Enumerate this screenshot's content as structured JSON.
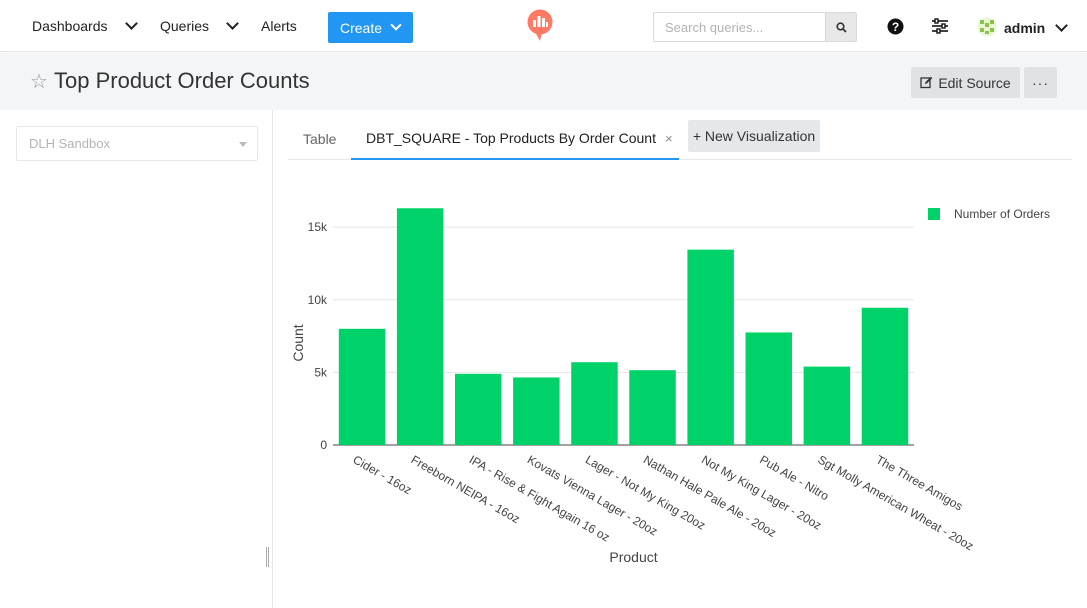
{
  "nav": {
    "dashboards": "Dashboards",
    "queries": "Queries",
    "alerts": "Alerts",
    "create": "Create",
    "search_placeholder": "Search queries...",
    "user": "admin"
  },
  "header": {
    "title": "Top Product Order Counts",
    "edit_source": "Edit Source",
    "more": "···"
  },
  "left": {
    "data_source": "DLH Sandbox"
  },
  "tabs": {
    "table": "Table",
    "active": "DBT_SQUARE - Top Products By Order Count",
    "close": "×",
    "new_visualization": "+ New Visualization"
  },
  "colors": {
    "accent": "#2196f3",
    "bar": "#00d26a"
  },
  "chart_data": {
    "type": "bar",
    "categories": [
      "Cider - 16oz",
      "Freeborn NEIPA - 16oz",
      "IPA - Rise & Fight Again 16 oz",
      "Kovats Vienna Lager - 20oz",
      "Lager - Not My King 20oz",
      "Nathan Hale Pale Ale - 20oz",
      "Not My King Lager - 20oz",
      "Pub Ale - Nitro",
      "Sgt Molly American Wheat - 20oz",
      "The Three Amigos"
    ],
    "series": [
      {
        "name": "Number of Orders",
        "values": [
          8000,
          16300,
          4900,
          4650,
          5700,
          5150,
          13450,
          7750,
          5400,
          9450
        ]
      }
    ],
    "xlabel": "Product",
    "ylabel": "Count",
    "ylim": [
      0,
      16800
    ],
    "yticks": [
      0,
      5000,
      10000,
      15000
    ],
    "ytick_labels": [
      "0",
      "5k",
      "10k",
      "15k"
    ],
    "grid": true,
    "legend": "top-right"
  }
}
